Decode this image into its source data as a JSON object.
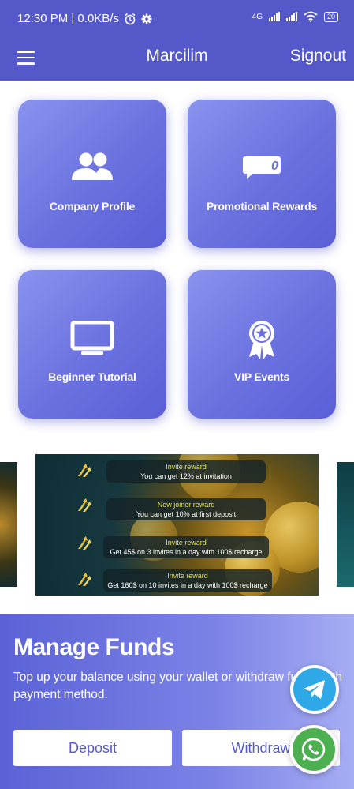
{
  "status_bar": {
    "time_net": "12:30 PM | 0.0KB/s",
    "network": "4G",
    "battery": "20"
  },
  "header": {
    "title": "Marcilim",
    "signout_label": "Signout"
  },
  "tiles": [
    {
      "label": "Company Profile",
      "icon": "people-icon"
    },
    {
      "label": "Promotional Rewards",
      "icon": "chat-badge-icon",
      "badge": "0"
    },
    {
      "label": "Beginner Tutorial",
      "icon": "monitor-icon"
    },
    {
      "label": "VIP Events",
      "icon": "award-icon"
    }
  ],
  "banner": {
    "rewards": [
      {
        "title": "Invite reward",
        "text": "You can get 12%  at invitation"
      },
      {
        "title": "New joiner reward",
        "text": "You can get 10% at first deposit"
      },
      {
        "title": "Invite reward",
        "text": "Get 45$ on 3 invites in a day with 100$ recharge"
      },
      {
        "title": "Invite reward",
        "text": "Get 160$ on 10 invites in a day with 100$ recharge"
      }
    ]
  },
  "funds": {
    "title": "Manage Funds",
    "description": "Top up your balance using your wallet or withdraw funds with payment method.",
    "deposit_label": "Deposit",
    "withdraw_label": "Withdraw"
  },
  "colors": {
    "primary": "#5458c9",
    "telegram": "#2ea8e6",
    "whatsapp": "#4caf50"
  }
}
